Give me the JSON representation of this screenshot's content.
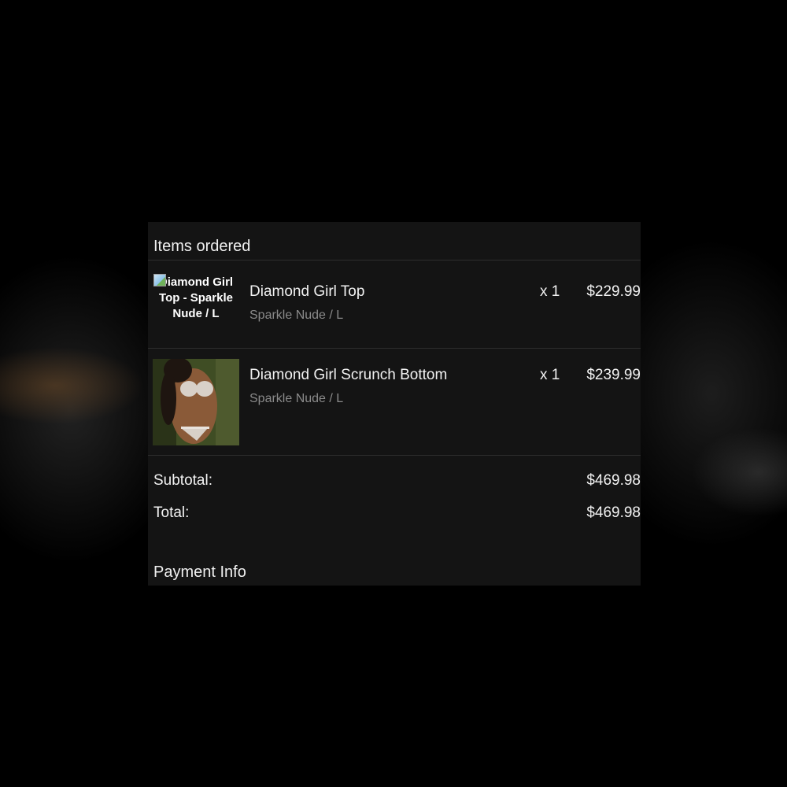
{
  "order": {
    "items_heading": "Items ordered",
    "items": [
      {
        "image_alt": "Diamond Girl Top - Sparkle Nude / L",
        "image_loaded": false,
        "name": "Diamond Girl Top",
        "variant": "Sparkle Nude / L",
        "quantity": "x 1",
        "price": "$229.99"
      },
      {
        "image_loaded": true,
        "name": "Diamond Girl Scrunch Bottom",
        "variant": "Sparkle Nude / L",
        "quantity": "x 1",
        "price": "$239.99"
      }
    ],
    "subtotal_label": "Subtotal:",
    "subtotal_value": "$469.98",
    "total_label": "Total:",
    "total_value": "$469.98",
    "payment_heading": "Payment Info"
  },
  "icons": {
    "broken_image": "broken-image-icon"
  },
  "colors": {
    "panel_background": "#141414",
    "page_background": "#000000",
    "text_primary": "#f2f2f2",
    "text_secondary": "#8a8a8a",
    "divider": "#2e2e2e"
  }
}
